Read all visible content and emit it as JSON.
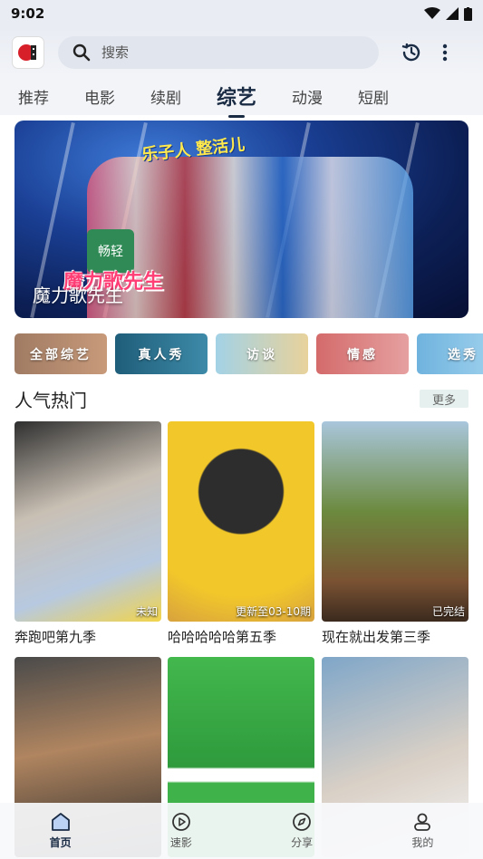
{
  "status_bar": {
    "time": "9:02"
  },
  "search": {
    "placeholder": "搜索"
  },
  "tabs": [
    {
      "label": "推荐",
      "active": false
    },
    {
      "label": "电影",
      "active": false
    },
    {
      "label": "续剧",
      "active": false
    },
    {
      "label": "综艺",
      "active": true
    },
    {
      "label": "动漫",
      "active": false
    },
    {
      "label": "短剧",
      "active": false
    }
  ],
  "banner": {
    "title": "魔力歌先生",
    "slogan": "乐子人 整活儿",
    "badge": "畅轻",
    "logo_text": "魔力歌先生"
  },
  "categories": [
    {
      "label": "全部综艺",
      "color": "#8a6d5d"
    },
    {
      "label": "真人秀",
      "color": "#2a6f8a"
    },
    {
      "label": "访谈",
      "color": "#8ec3d9"
    },
    {
      "label": "情感",
      "color": "#d77c7c"
    },
    {
      "label": "选秀",
      "color": "#79b7d9"
    }
  ],
  "section": {
    "title": "人气热门",
    "more_label": "更多"
  },
  "cards": [
    {
      "title": "奔跑吧第九季",
      "status": "未知",
      "colors": [
        "#3b3b3b",
        "#c9c0b4",
        "#6fa0d8"
      ]
    },
    {
      "title": "哈哈哈哈哈第五季",
      "status": "更新至03-10期",
      "colors": [
        "#f2c72a",
        "#d8a51b",
        "#4a4a4a"
      ]
    },
    {
      "title": "现在就出发第三季",
      "status": "已完结",
      "colors": [
        "#a4c2d8",
        "#5f7f3a",
        "#8a5a3a"
      ]
    },
    {
      "title": "",
      "status": "",
      "colors": [
        "#3a3a3a",
        "#8c6b4e",
        "#2a2a2a"
      ]
    },
    {
      "title": "",
      "status": "",
      "colors": [
        "#3fb24a",
        "#2e9a3c",
        "#ffffff"
      ]
    },
    {
      "title": "",
      "status": "",
      "colors": [
        "#7fa6c8",
        "#d9d0c6",
        "#ffffff"
      ]
    }
  ],
  "bottom_nav": [
    {
      "label": "首页",
      "icon": "home-icon",
      "active": true
    },
    {
      "label": "速影",
      "icon": "play-icon",
      "active": false
    },
    {
      "label": "分享",
      "icon": "compass-icon",
      "active": false
    },
    {
      "label": "我的",
      "icon": "user-icon",
      "active": false
    }
  ]
}
